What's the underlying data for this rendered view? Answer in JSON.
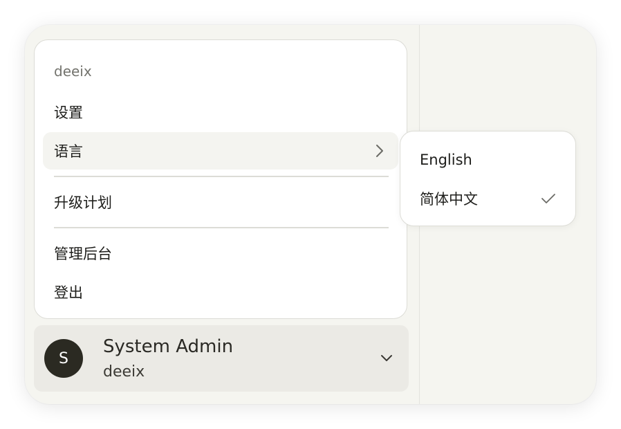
{
  "menu": {
    "header": "deeix",
    "items": [
      {
        "label": "设置"
      },
      {
        "label": "语言",
        "has_submenu": true,
        "active": true
      },
      {
        "label": "升级计划"
      },
      {
        "label": "管理后台"
      },
      {
        "label": "登出"
      }
    ]
  },
  "language_submenu": {
    "options": [
      {
        "label": "English",
        "selected": false
      },
      {
        "label": "简体中文",
        "selected": true
      }
    ]
  },
  "user": {
    "avatar_initial": "S",
    "name": "System Admin",
    "handle": "deeix"
  },
  "icons": {
    "submenu_arrow": "chevron-right-icon",
    "selected_mark": "checkmark-icon",
    "user_dropdown": "chevron-down-icon"
  },
  "colors": {
    "window_bg": "#f5f5f0",
    "menu_bg": "#ffffff",
    "active_item_bg": "#f4f4f0",
    "user_card_bg": "#ebeae5",
    "avatar_bg": "#2b2a22",
    "text_primary": "#1e1e1b",
    "text_muted": "#73736d"
  }
}
